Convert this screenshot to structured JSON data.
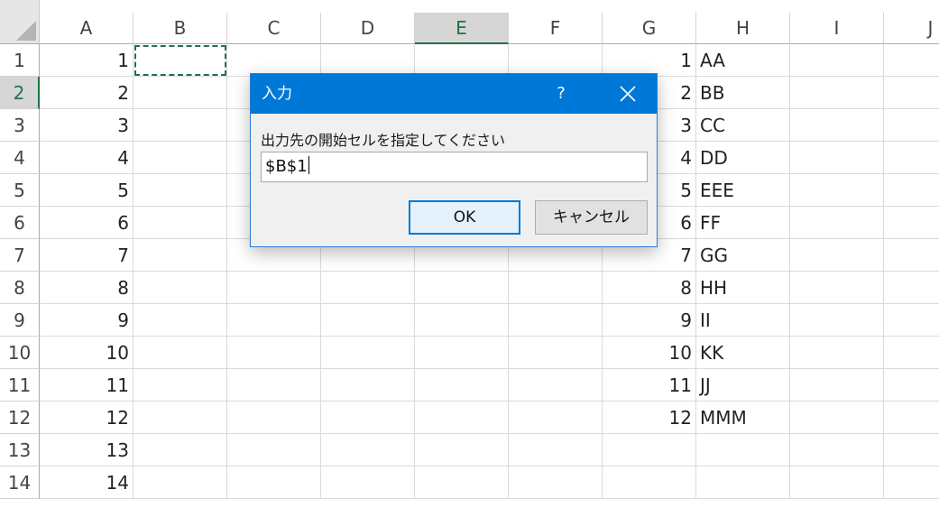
{
  "columns": [
    "A",
    "B",
    "C",
    "D",
    "E",
    "F",
    "G",
    "H",
    "I",
    "J"
  ],
  "selected_column": "E",
  "rows": [
    "1",
    "2",
    "3",
    "4",
    "5",
    "6",
    "7",
    "8",
    "9",
    "10",
    "11",
    "12",
    "13",
    "14"
  ],
  "selected_row": "2",
  "column_a_values": [
    "1",
    "2",
    "3",
    "4",
    "5",
    "6",
    "7",
    "8",
    "9",
    "10",
    "11",
    "12",
    "13",
    "14"
  ],
  "column_g_values": [
    "1",
    "2",
    "3",
    "4",
    "5",
    "6",
    "7",
    "8",
    "9",
    "10",
    "11",
    "12"
  ],
  "column_h_values": [
    "AA",
    "BB",
    "CC",
    "DD",
    "EEE",
    "FF",
    "GG",
    "HH",
    "II",
    "KK",
    "JJ",
    "MMM"
  ],
  "dialog": {
    "title": "入力",
    "help": "?",
    "prompt": "出力先の開始セルを指定してください",
    "input_value": "$B$1",
    "ok_label": "OK",
    "cancel_label": "キャンセル"
  },
  "colors": {
    "accent": "#217346",
    "dialog_title_bg": "#0078d7"
  }
}
